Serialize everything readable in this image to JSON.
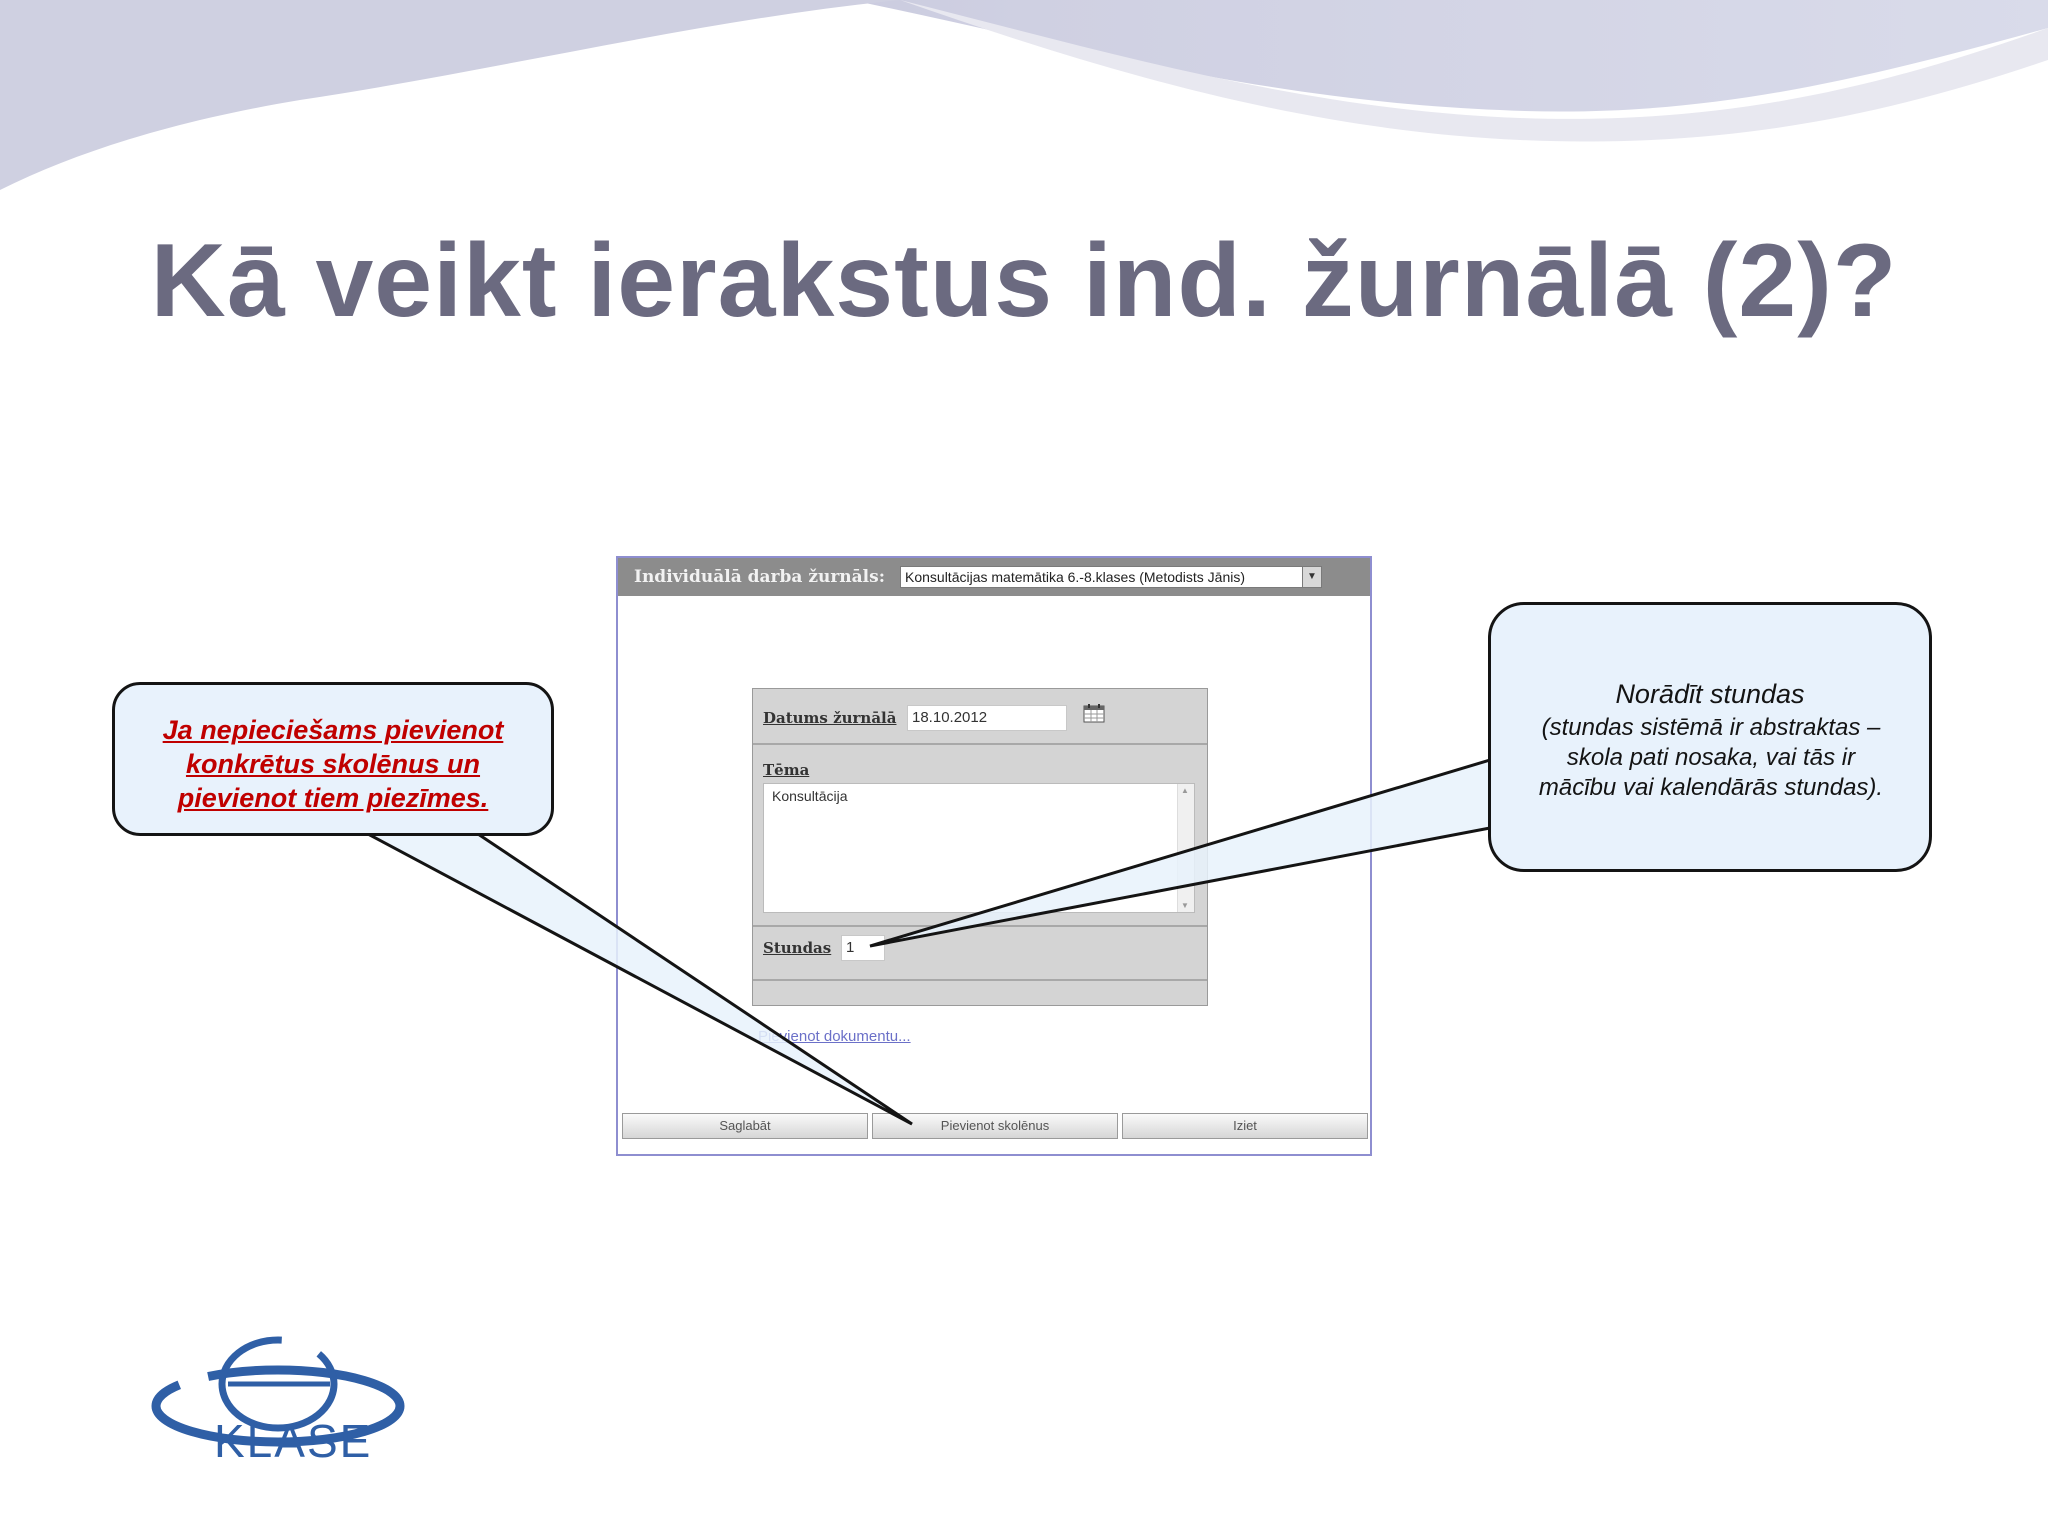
{
  "slide": {
    "title": "Kā veikt ierakstus ind. žurnālā (2)?"
  },
  "app": {
    "header_label": "Individuālā darba žurnāls:",
    "journal_select_value": "Konsultācijas matemātika 6.-8.klases (Metodists Jānis)",
    "form": {
      "date_label": "Datums žurnālā",
      "date_value": "18.10.2012",
      "topic_label": "Tēma",
      "topic_value": "Konsultācija",
      "hours_label": "Stundas",
      "hours_value": "1"
    },
    "attach_link": "Pievienot dokumentu...",
    "buttons": {
      "save": "Saglabāt",
      "add_students": "Pievienot skolēnus",
      "exit": "Iziet"
    }
  },
  "callouts": {
    "left_lines": [
      "Ja nepieciešams pievienot",
      "konkrētus skolēnus un",
      "pievienot tiem piezīmes."
    ],
    "right_heading": "Norādīt stundas",
    "right_lines": [
      "(stundas sistēmā ir abstraktas –",
      "skola pati nosaka, vai tās ir",
      "mācību vai kalendārās stundas)."
    ]
  },
  "logo": {
    "text": "KLASE"
  },
  "colors": {
    "title": "#6b6a80",
    "callout_fill": "#e8f2fc",
    "callout_left_text": "#c00000",
    "logo": "#2f5fa6",
    "app_header": "#8c8c8c"
  }
}
